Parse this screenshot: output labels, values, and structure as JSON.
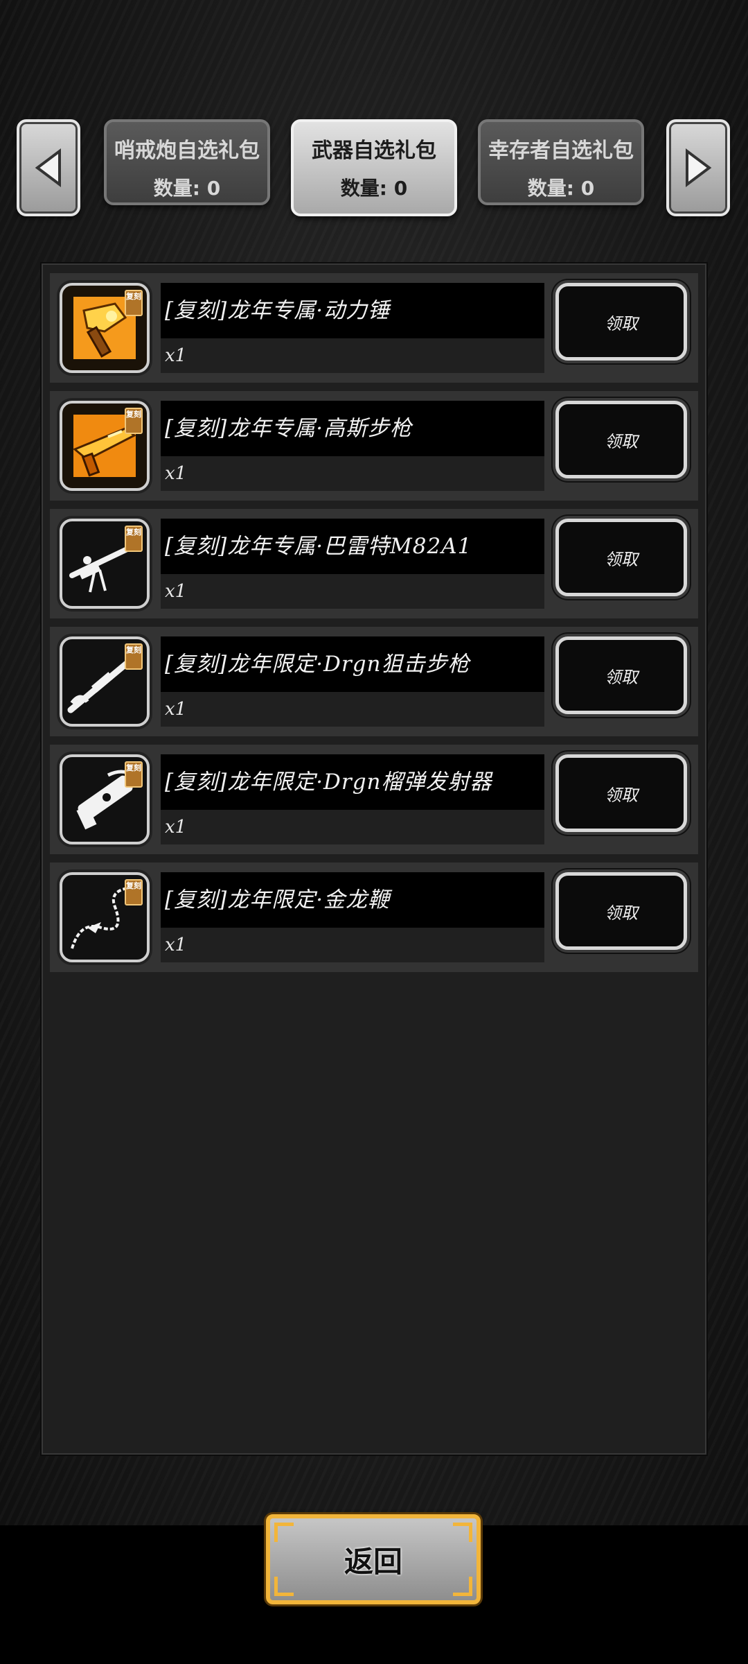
{
  "tabs": [
    {
      "title": "哨戒炮自选礼包",
      "count": "数量: 0",
      "active": false
    },
    {
      "title": "武器自选礼包",
      "count": "数量: 0",
      "active": true
    },
    {
      "title": "幸存者自选礼包",
      "count": "数量: 0",
      "active": false
    }
  ],
  "items": [
    {
      "name": "[复刻]龙年专属·动力锤",
      "qty": "x1",
      "claim": "领取",
      "tag": "复刻",
      "icon": "power-hammer-icon"
    },
    {
      "name": "[复刻]龙年专属·高斯步枪",
      "qty": "x1",
      "claim": "领取",
      "tag": "复刻",
      "icon": "gauss-rifle-icon"
    },
    {
      "name": "[复刻]龙年专属·巴雷特M82A1",
      "qty": "x1",
      "claim": "领取",
      "tag": "复刻",
      "icon": "barrett-rifle-icon"
    },
    {
      "name": "[复刻]龙年限定·Drgn狙击步枪",
      "qty": "x1",
      "claim": "领取",
      "tag": "复刻",
      "icon": "sniper-rifle-icon"
    },
    {
      "name": "[复刻]龙年限定·Drgn榴弹发射器",
      "qty": "x1",
      "claim": "领取",
      "tag": "复刻",
      "icon": "grenade-launcher-icon"
    },
    {
      "name": "[复刻]龙年限定·金龙鞭",
      "qty": "x1",
      "claim": "领取",
      "tag": "复刻",
      "icon": "dragon-whip-icon"
    }
  ],
  "back_label": "返回",
  "colors": {
    "gold_accent": "#f2b53a",
    "row_bg": "#333333",
    "name_bar": "#000000"
  }
}
